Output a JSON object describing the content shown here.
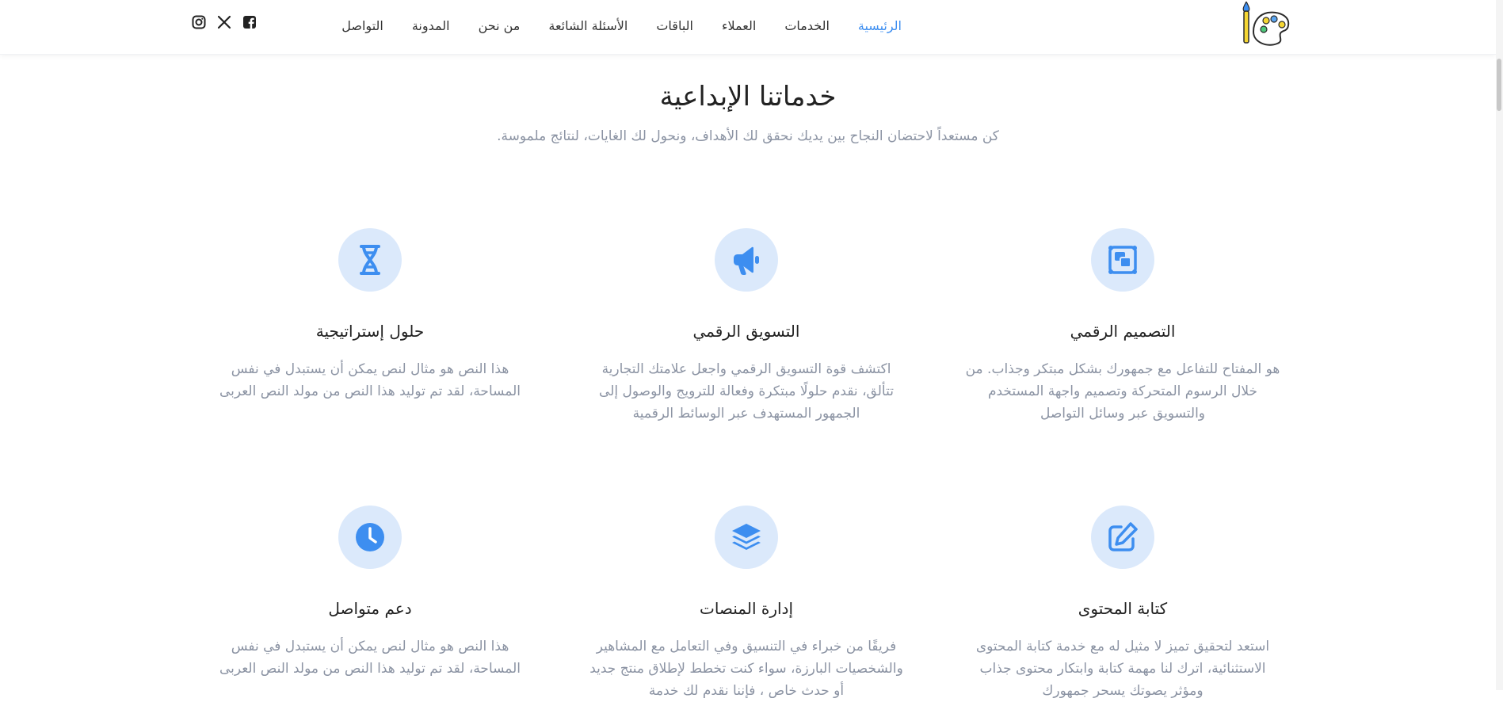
{
  "nav": {
    "items": [
      "الرئيسية",
      "الخدمات",
      "العملاء",
      "الباقات",
      "الأسئلة الشائعة",
      "من نحن",
      "المدونة",
      "التواصل"
    ]
  },
  "social": [
    "instagram-icon",
    "x-icon",
    "facebook-icon"
  ],
  "services": {
    "title": "خدماتنا الإبداعية",
    "subtitle": "كن مستعداً لاحتضان النجاح بين يديك نحقق لك الأهداف، ونحول لك الغايات، لنتائج ملموسة.",
    "cards": [
      {
        "icon": "design-icon",
        "title": "التصميم الرقمي",
        "desc": "هو المفتاح للتفاعل مع جمهورك بشكل مبتكر وجذاب. من خلال الرسوم المتحركة وتصميم واجهة المستخدم والتسويق عبر وسائل التواصل"
      },
      {
        "icon": "megaphone-icon",
        "title": "التسويق الرقمي",
        "desc": "اكتشف قوة التسويق الرقمي واجعل علامتك التجارية تتألق، نقدم حلولًا مبتكرة وفعالة للترويج والوصول إلى الجمهور المستهدف عبر الوسائط الرقمية"
      },
      {
        "icon": "dna-icon",
        "title": "حلول إستراتيجية",
        "desc": "هذا النص هو مثال لنص يمكن أن يستبدل في نفس المساحة، لقد تم توليد هذا النص من مولد النص العربى"
      },
      {
        "icon": "edit-icon",
        "title": "كتابة المحتوى",
        "desc": "استعد لتحقيق تميز لا مثيل له مع خدمة كتابة المحتوى الاستثنائية، اترك لنا مهمة كتابة وابتكار محتوى جذاب ومؤثر يصوتك يسحر جمهورك"
      },
      {
        "icon": "layers-icon",
        "title": "إدارة المنصات",
        "desc": "فريقًا من خبراء في التنسيق وفي التعامل مع المشاهير والشخصيات البارزة، سواء كنت تخطط لإطلاق منتج جديد أو حدث خاص ، فإننا نقدم لك خدمة"
      },
      {
        "icon": "clock-icon",
        "title": "دعم متواصل",
        "desc": "هذا النص هو مثال لنص يمكن أن يستبدل في نفس المساحة، لقد تم توليد هذا النص من مولد النص العربى"
      }
    ]
  },
  "colors": {
    "accent": "#3d8ef0",
    "icon_bg": "#dbe9fb",
    "muted_text": "#8b93a3"
  }
}
